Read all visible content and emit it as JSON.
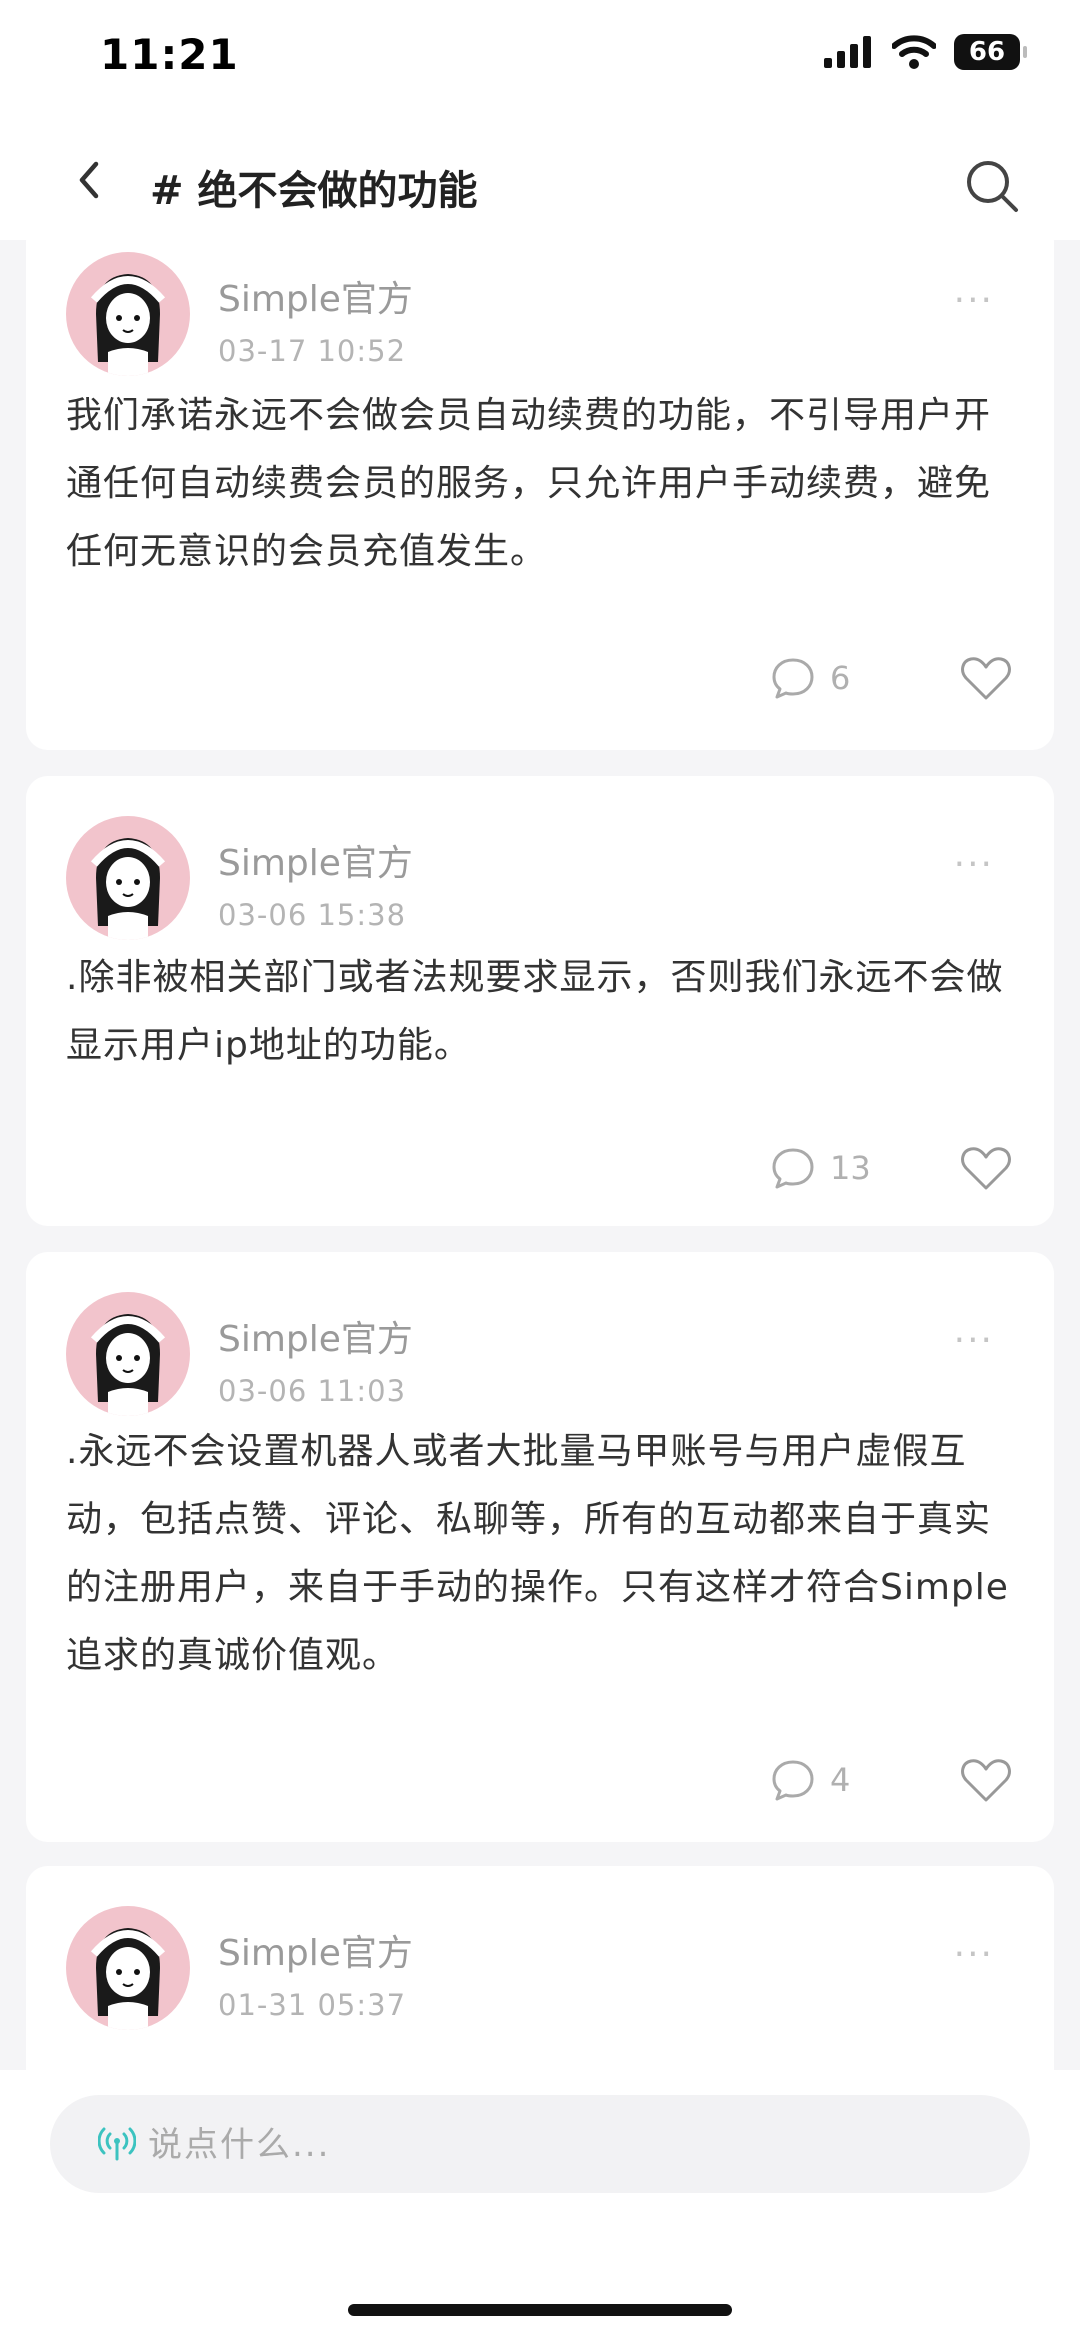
{
  "status": {
    "time": "11:21",
    "battery": "66"
  },
  "nav": {
    "title": "# 绝不会做的功能"
  },
  "posts": [
    {
      "user": "Simple官方",
      "time": "03-17 10:52",
      "content": "我们承诺永远不会做会员自动续费的功能，不引导用户开通任何自动续费会员的服务，只允许用户手动续费，避免任何无意识的会员充值发生。",
      "comments": "6"
    },
    {
      "user": "Simple官方",
      "time": "03-06 15:38",
      "content": ".除非被相关部门或者法规要求显示，否则我们永远不会做显示用户ip地址的功能。",
      "comments": "13"
    },
    {
      "user": "Simple官方",
      "time": "03-06 11:03",
      "content": ".永远不会设置机器人或者大批量马甲账号与用户虚假互动，包括点赞、评论、私聊等，所有的互动都来自于真实的注册用户，来自于手动的操作。只有这样才符合Simple追求的真诚价值观。",
      "comments": "4"
    },
    {
      "user": "Simple官方",
      "time": "01-31 05:37"
    }
  ],
  "input": {
    "placeholder": "说点什么..."
  },
  "icons": {
    "back": "chevron-left-icon",
    "search": "search-icon",
    "comment": "speech-bubble-icon",
    "like": "heart-icon",
    "more": "more-dots-icon",
    "input": "broadcast-icon"
  },
  "colors": {
    "accent": "#3cc3c0",
    "avatar_bg": "#f2c4cc",
    "meta_text": "#9a9a9a"
  }
}
